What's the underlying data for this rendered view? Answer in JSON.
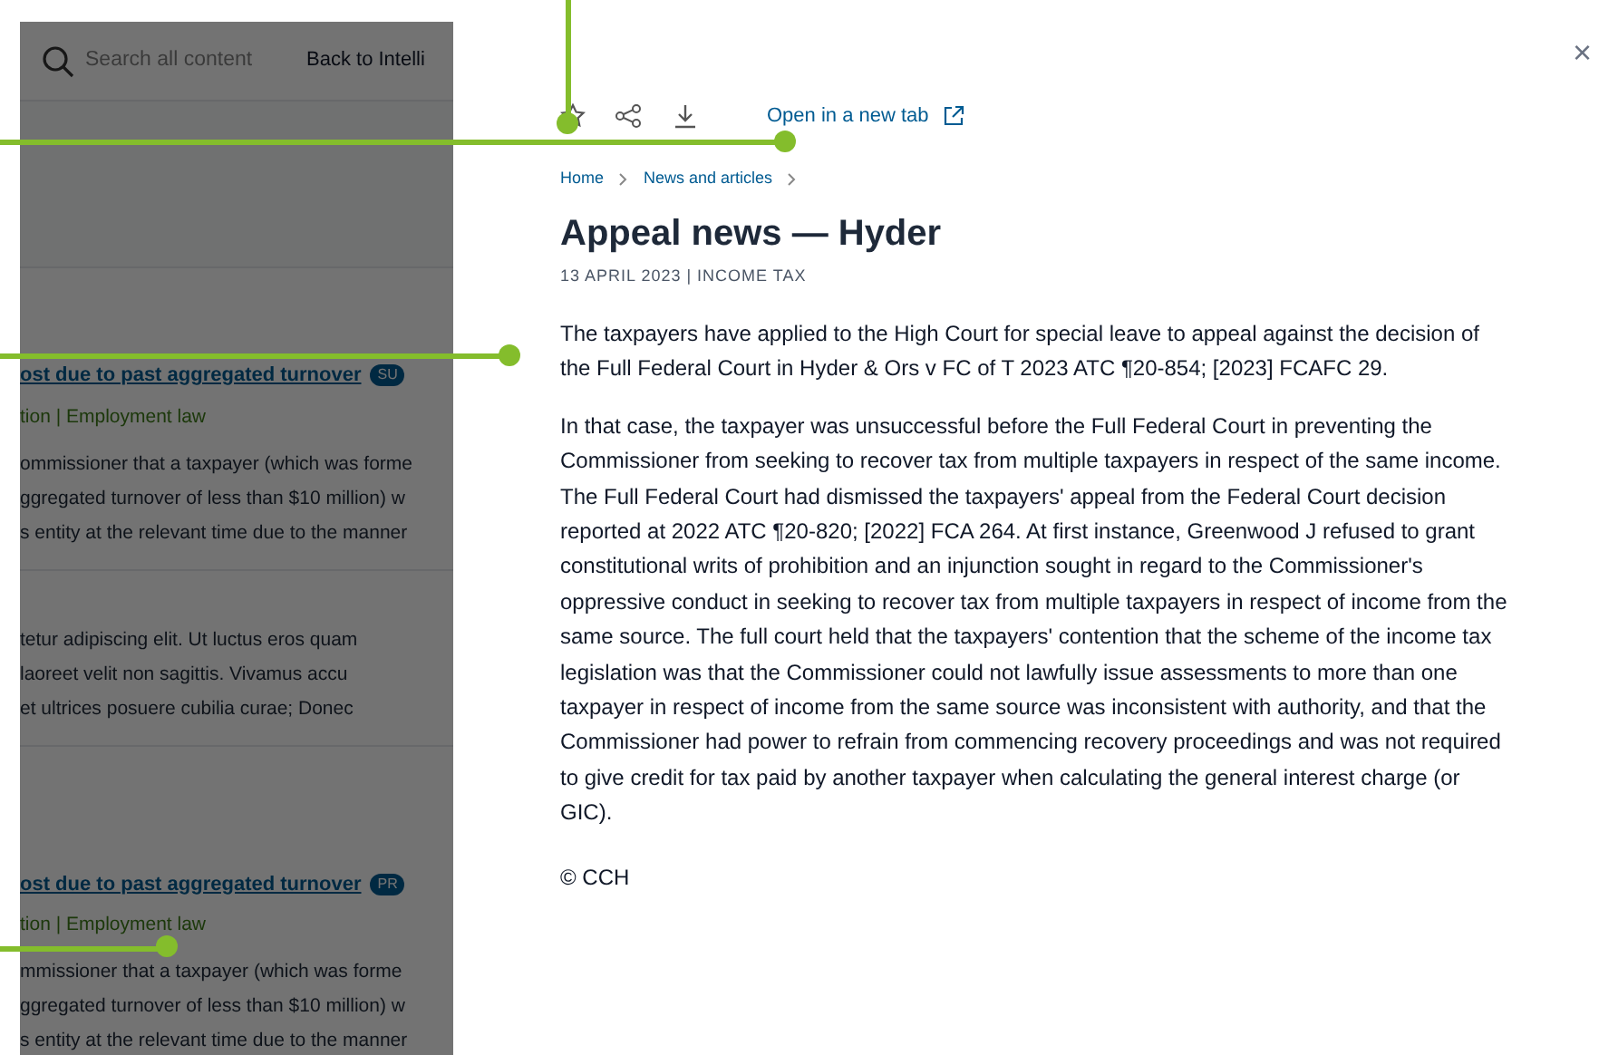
{
  "background_page": {
    "search": {
      "placeholder": "Search all content"
    },
    "back_link": "Back to Intelli",
    "results": [
      {
        "title": "ost due to past aggregated turnover",
        "badge": "SU",
        "meta": "tion | Employment law",
        "snippet": [
          "ommissioner that a taxpayer (which was forme",
          "ggregated turnover of less than $10 million) w",
          "s entity at the relevant time due to the manner"
        ]
      },
      {
        "snippet": [
          "tetur adipiscing elit. Ut luctus eros quam",
          "laoreet velit non sagittis. Vivamus accu",
          "et ultrices posuere cubilia curae; Donec"
        ]
      },
      {
        "title": "ost due to past aggregated turnover",
        "badge": "PR",
        "meta": "tion | Employment law",
        "snippet": [
          "mmissioner that a taxpayer (which was forme",
          "ggregated turnover of less than $10 million) w",
          "s entity at the relevant time due to the manner"
        ]
      }
    ]
  },
  "panel": {
    "open_link": "Open in a new tab",
    "close": "×",
    "breadcrumb": [
      "Home",
      "News and articles"
    ],
    "title": "Appeal news — Hyder",
    "meta": "13 APRIL 2023 | INCOME TAX",
    "paragraphs": [
      "The taxpayers have applied to the High Court for special leave to appeal against the decision of the Full Federal Court in Hyder & Ors v FC of T 2023 ATC ¶20-854; [2023] FCAFC 29.",
      "In that case, the taxpayer was unsuccessful before the Full Federal Court in preventing the Commissioner from seeking to recover tax from multiple taxpayers in respect of the same income. The Full Federal Court had dismissed the taxpayers' appeal from the Federal Court decision reported at 2022 ATC ¶20-820; [2022] FCA 264. At first instance, Greenwood J refused to grant constitutional writs of prohibition and an injunction sought in regard to the Commissioner's oppressive conduct in seeking to recover tax from multiple taxpayers in respect of income from the same source. The full court held that the taxpayers' contention that the scheme of the income tax legislation was that the Commissioner could not lawfully issue assessments to more than one taxpayer in respect of income from the same source was inconsistent with authority, and that the Commissioner had power to refrain from commencing recovery proceedings and was not required to give credit for tax paid by another taxpayer when calculating the general interest charge (or GIC)."
    ],
    "footer": "© CCH"
  }
}
